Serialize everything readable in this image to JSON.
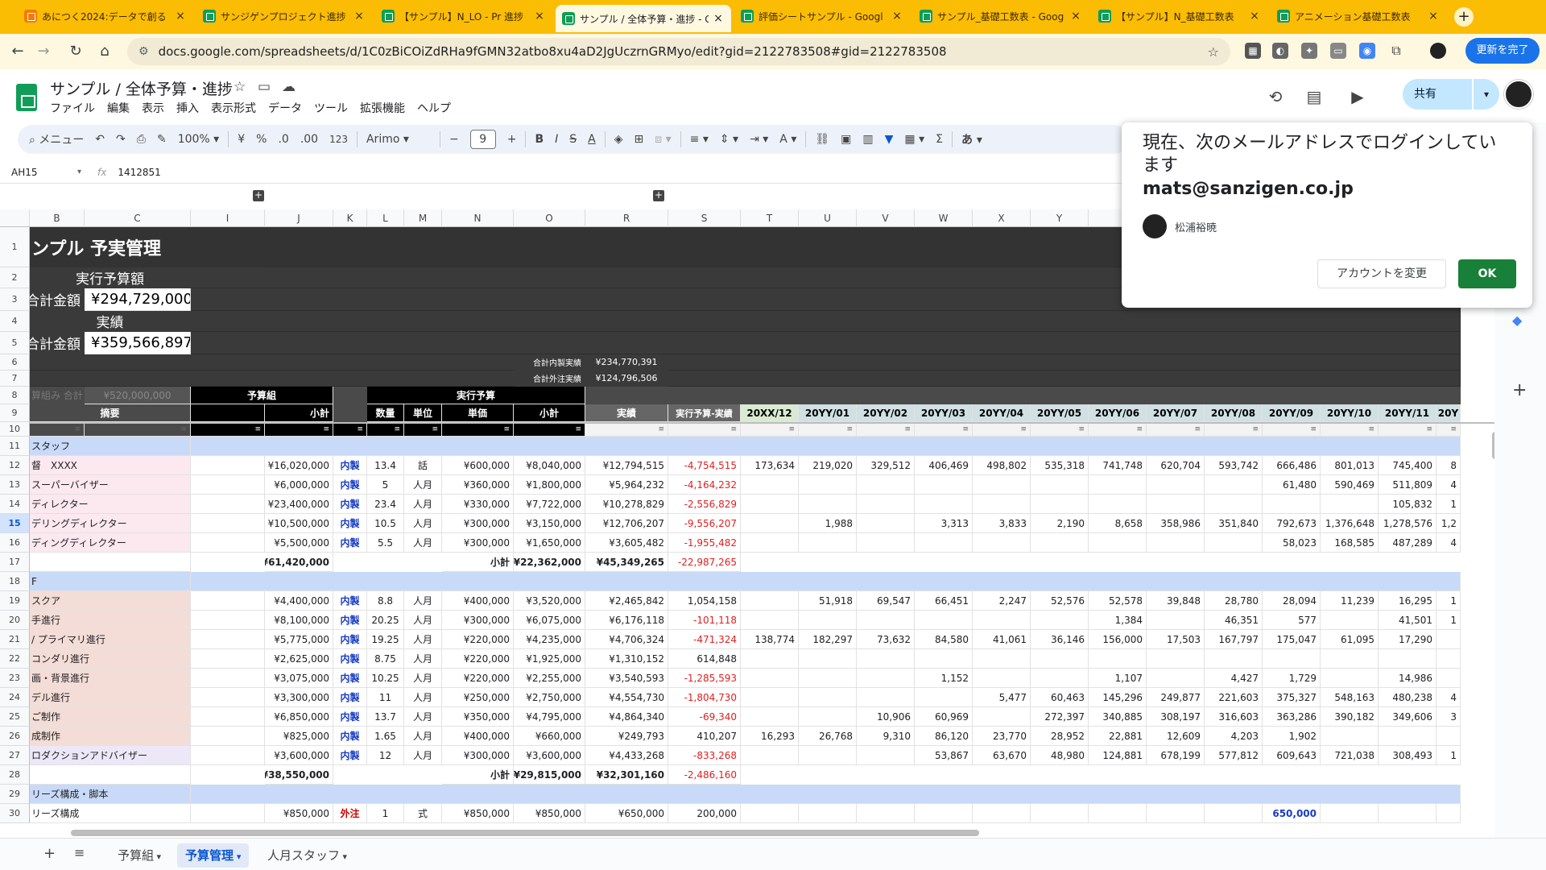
{
  "browser": {
    "tabs": [
      {
        "title": "あにつく2024:データで創る",
        "active": false,
        "fav": "orange"
      },
      {
        "title": "サンジゲンプロジェクト進捗",
        "active": false,
        "fav": "green"
      },
      {
        "title": "【サンプル】N_LO - Pr 進捗",
        "active": false,
        "fav": "green"
      },
      {
        "title": "サンプル / 全体予算・進捗 - G",
        "active": true,
        "fav": "green"
      },
      {
        "title": "評価シートサンプル - Googl",
        "active": false,
        "fav": "green"
      },
      {
        "title": "サンプル_基礎工数表 - Goog",
        "active": false,
        "fav": "green"
      },
      {
        "title": "【サンプル】N_基礎工数表",
        "active": false,
        "fav": "green"
      },
      {
        "title": "アニメーション基礎工数表",
        "active": false,
        "fav": "green"
      }
    ],
    "url": "docs.google.com/spreadsheets/d/1C0zBiCOiZdRHa9fGMN32atbo8xu4aD2JgUczrnGRMyo/edit?gid=2122783508#gid=2122783508",
    "update_label": "更新を完了"
  },
  "sheets": {
    "title": "サンプル / 全体予算・進捗",
    "menu": [
      "ファイル",
      "編集",
      "表示",
      "挿入",
      "表示形式",
      "データ",
      "ツール",
      "拡張機能",
      "ヘルプ"
    ],
    "share_label": "共有",
    "toolbar": {
      "search": "メニュー",
      "zoom": "100%",
      "currency": "¥",
      "percent": "%",
      "dec_dec": ".0",
      "inc_dec": ".00",
      "number": "123",
      "font": "Arimo",
      "font_size": "9"
    },
    "name_box": "AH15",
    "formula": "1412851"
  },
  "grid": {
    "columns": [
      {
        "name": "B",
        "w": 68
      },
      {
        "name": "C",
        "w": 132
      },
      {
        "name": "I",
        "w": 92
      },
      {
        "name": "J",
        "w": 85
      },
      {
        "name": "K",
        "w": 42
      },
      {
        "name": "L",
        "w": 46
      },
      {
        "name": "M",
        "w": 47
      },
      {
        "name": "N",
        "w": 89
      },
      {
        "name": "O",
        "w": 89
      },
      {
        "name": "R",
        "w": 103
      },
      {
        "name": "S",
        "w": 90
      },
      {
        "name": "T",
        "w": 72
      },
      {
        "name": "U",
        "w": 72
      },
      {
        "name": "V",
        "w": 72
      },
      {
        "name": "W",
        "w": 72
      },
      {
        "name": "X",
        "w": 72
      },
      {
        "name": "Y",
        "w": 72
      },
      {
        "name": "Z",
        "w": 72
      },
      {
        "name": "AA",
        "w": 72
      },
      {
        "name": "AB",
        "w": 72
      },
      {
        "name": "AC",
        "w": 72
      },
      {
        "name": "AD",
        "w": 72
      },
      {
        "name": "AE",
        "w": 72
      },
      {
        "name": "AF",
        "w": 30
      }
    ],
    "visible_col_letters": [
      "B",
      "C",
      "I",
      "J",
      "K",
      "L",
      "M",
      "N",
      "O",
      "R",
      "S",
      "T",
      "U",
      "V",
      "W",
      "X",
      "Y"
    ],
    "rows": [
      {
        "n": "1",
        "h": 50
      },
      {
        "n": "2",
        "h": 26
      },
      {
        "n": "3",
        "h": 28
      },
      {
        "n": "4",
        "h": 26
      },
      {
        "n": "5",
        "h": 28
      },
      {
        "n": "6",
        "h": 20
      },
      {
        "n": "7",
        "h": 20
      },
      {
        "n": "8",
        "h": 22
      },
      {
        "n": "9",
        "h": 22
      },
      {
        "n": "10",
        "h": 18
      },
      {
        "n": "11",
        "h": 24
      },
      {
        "n": "12",
        "h": 24
      },
      {
        "n": "13",
        "h": 24
      },
      {
        "n": "14",
        "h": 24
      },
      {
        "n": "15",
        "h": 24
      },
      {
        "n": "16",
        "h": 24
      },
      {
        "n": "17",
        "h": 24
      },
      {
        "n": "18",
        "h": 24
      },
      {
        "n": "19",
        "h": 24
      },
      {
        "n": "20",
        "h": 24
      },
      {
        "n": "21",
        "h": 24
      },
      {
        "n": "22",
        "h": 24
      },
      {
        "n": "23",
        "h": 24
      },
      {
        "n": "24",
        "h": 24
      },
      {
        "n": "25",
        "h": 24
      },
      {
        "n": "26",
        "h": 24
      },
      {
        "n": "27",
        "h": 24
      },
      {
        "n": "28",
        "h": 24
      },
      {
        "n": "29",
        "h": 24
      },
      {
        "n": "30",
        "h": 24
      }
    ],
    "selected_row": "15",
    "header_block": {
      "title": "ンプル 予実管理",
      "budget_label": "実行予算額",
      "budget_total_label": "合計金額",
      "budget_total": "¥294,729,000",
      "actual_label": "実績",
      "actual_total_label": "合計金額",
      "actual_total": "¥359,566,897",
      "inhouse_label": "合計内製実績",
      "inhouse_value": "¥234,770,391",
      "outsource_label": "合計外注実績",
      "outsource_value": "¥124,796,506",
      "kumi_label": "算組み 合計",
      "kumi_value": "¥520,000,000",
      "yosan_kumi": "予算組",
      "jikko_yosan": "実行予算",
      "tekiyo": "摘要",
      "shokei": "小計",
      "suryo": "数量",
      "tani": "単位",
      "tanka": "単価",
      "shokei2": "小計",
      "jisseki": "実績",
      "diff": "実行予算-実績",
      "months": [
        "20XX/12",
        "20YY/01",
        "20YY/02",
        "20YY/03",
        "20YY/04",
        "20YY/05",
        "20YY/06",
        "20YY/07",
        "20YY/08",
        "20YY/09",
        "20YY/10",
        "20YY/11",
        "20Y"
      ]
    },
    "data_rows": [
      {
        "row": "11",
        "type": "section",
        "label": "スタッフ"
      },
      {
        "row": "12",
        "name": "XXXX",
        "pre": "督",
        "J": "¥16,020,000",
        "K": "内製",
        "L": "13.4",
        "M": "話",
        "N": "¥600,000",
        "O": "¥8,040,000",
        "R": "¥12,794,515",
        "S": "-4,754,515",
        "m": [
          "173,634",
          "219,020",
          "329,512",
          "406,469",
          "498,802",
          "535,318",
          "741,748",
          "620,704",
          "593,742",
          "666,486",
          "801,013",
          "745,400",
          "8"
        ]
      },
      {
        "row": "13",
        "name": "スーパーバイザー",
        "J": "¥6,000,000",
        "K": "内製",
        "L": "5",
        "M": "人月",
        "N": "¥360,000",
        "O": "¥1,800,000",
        "R": "¥5,964,232",
        "S": "-4,164,232",
        "m": [
          "",
          "",
          "",
          "",
          "",
          "",
          "",
          "",
          "",
          "61,480",
          "590,469",
          "511,809",
          "4"
        ]
      },
      {
        "row": "14",
        "name": "ディレクター",
        "J": "¥23,400,000",
        "K": "内製",
        "L": "23.4",
        "M": "人月",
        "N": "¥330,000",
        "O": "¥7,722,000",
        "R": "¥10,278,829",
        "S": "-2,556,829",
        "m": [
          "",
          "",
          "",
          "",
          "",
          "",
          "",
          "",
          "",
          "",
          "",
          "105,832",
          "1"
        ]
      },
      {
        "row": "15",
        "name": "デリングディレクター",
        "J": "¥10,500,000",
        "K": "内製",
        "L": "10.5",
        "M": "人月",
        "N": "¥300,000",
        "O": "¥3,150,000",
        "R": "¥12,706,207",
        "S": "-9,556,207",
        "m": [
          "",
          "1,988",
          "",
          "3,313",
          "3,833",
          "2,190",
          "8,658",
          "358,986",
          "351,840",
          "792,673",
          "1,376,648",
          "1,278,576",
          "1,2"
        ]
      },
      {
        "row": "16",
        "name": "ディングディレクター",
        "J": "¥5,500,000",
        "K": "内製",
        "L": "5.5",
        "M": "人月",
        "N": "¥300,000",
        "O": "¥1,650,000",
        "R": "¥3,605,482",
        "S": "-1,955,482",
        "m": [
          "",
          "",
          "",
          "",
          "",
          "",
          "",
          "",
          "",
          "58,023",
          "168,585",
          "487,289",
          "4"
        ]
      },
      {
        "row": "17",
        "type": "subtotal",
        "J": "¥61,420,000",
        "N": "小計",
        "O": "¥22,362,000",
        "R": "¥45,349,265",
        "S": "-22,987,265"
      },
      {
        "row": "18",
        "type": "section",
        "label": "F"
      },
      {
        "row": "19",
        "name": "スクア",
        "J": "¥4,400,000",
        "K": "内製",
        "L": "8.8",
        "M": "人月",
        "N": "¥400,000",
        "O": "¥3,520,000",
        "R": "¥2,465,842",
        "S": "1,054,158",
        "m": [
          "",
          "51,918",
          "69,547",
          "66,451",
          "2,247",
          "52,576",
          "52,578",
          "39,848",
          "28,780",
          "28,094",
          "11,239",
          "16,295",
          "1"
        ]
      },
      {
        "row": "20",
        "name": "手進行",
        "J": "¥8,100,000",
        "K": "内製",
        "L": "20.25",
        "M": "人月",
        "N": "¥300,000",
        "O": "¥6,075,000",
        "R": "¥6,176,118",
        "S": "-101,118",
        "m": [
          "",
          "",
          "",
          "",
          "",
          "",
          "1,384",
          "",
          "46,351",
          "577",
          "",
          "41,501",
          "1"
        ]
      },
      {
        "row": "21",
        "name": "/ プライマリ進行",
        "J": "¥5,775,000",
        "K": "内製",
        "L": "19.25",
        "M": "人月",
        "N": "¥220,000",
        "O": "¥4,235,000",
        "R": "¥4,706,324",
        "S": "-471,324",
        "m": [
          "138,774",
          "182,297",
          "73,632",
          "84,580",
          "41,061",
          "36,146",
          "156,000",
          "17,503",
          "167,797",
          "175,047",
          "61,095",
          "17,290",
          ""
        ]
      },
      {
        "row": "22",
        "name": "コンダリ進行",
        "J": "¥2,625,000",
        "K": "内製",
        "L": "8.75",
        "M": "人月",
        "N": "¥220,000",
        "O": "¥1,925,000",
        "R": "¥1,310,152",
        "S": "614,848",
        "m": [
          "",
          "",
          "",
          "",
          "",
          "",
          "",
          "",
          "",
          "",
          "",
          "",
          ""
        ]
      },
      {
        "row": "23",
        "name": "画・背景進行",
        "J": "¥3,075,000",
        "K": "内製",
        "L": "10.25",
        "M": "人月",
        "N": "¥220,000",
        "O": "¥2,255,000",
        "R": "¥3,540,593",
        "S": "-1,285,593",
        "m": [
          "",
          "",
          "",
          "1,152",
          "",
          "",
          "1,107",
          "",
          "4,427",
          "1,729",
          "",
          "14,986",
          ""
        ]
      },
      {
        "row": "24",
        "name": "デル進行",
        "J": "¥3,300,000",
        "K": "内製",
        "L": "11",
        "M": "人月",
        "N": "¥250,000",
        "O": "¥2,750,000",
        "R": "¥4,554,730",
        "S": "-1,804,730",
        "m": [
          "",
          "",
          "",
          "",
          "5,477",
          "60,463",
          "145,296",
          "249,877",
          "221,603",
          "375,327",
          "548,163",
          "480,238",
          "4"
        ]
      },
      {
        "row": "25",
        "name": "ご制作",
        "J": "¥6,850,000",
        "K": "内製",
        "L": "13.7",
        "M": "人月",
        "N": "¥350,000",
        "O": "¥4,795,000",
        "R": "¥4,864,340",
        "S": "-69,340",
        "m": [
          "",
          "",
          "10,906",
          "60,969",
          "",
          "272,397",
          "340,885",
          "308,197",
          "316,603",
          "363,286",
          "390,182",
          "349,606",
          "3"
        ]
      },
      {
        "row": "26",
        "name": "成制作",
        "J": "¥825,000",
        "K": "内製",
        "L": "1.65",
        "M": "人月",
        "N": "¥400,000",
        "O": "¥660,000",
        "R": "¥249,793",
        "S": "410,207",
        "m": [
          "16,293",
          "26,768",
          "9,310",
          "86,120",
          "23,770",
          "28,952",
          "22,881",
          "12,609",
          "4,203",
          "1,902",
          "",
          "",
          ""
        ]
      },
      {
        "row": "27",
        "name": "ロダクションアドバイザー",
        "J": "¥3,600,000",
        "K": "内製",
        "L": "12",
        "M": "人月",
        "N": "¥300,000",
        "O": "¥3,600,000",
        "R": "¥4,433,268",
        "S": "-833,268",
        "m": [
          "",
          "",
          "",
          "53,867",
          "63,670",
          "48,980",
          "124,881",
          "678,199",
          "577,812",
          "609,643",
          "721,038",
          "308,493",
          "1"
        ]
      },
      {
        "row": "28",
        "type": "subtotal",
        "J": "¥38,550,000",
        "N": "小計",
        "O": "¥29,815,000",
        "R": "¥32,301,160",
        "S": "-2,486,160"
      },
      {
        "row": "29",
        "type": "section",
        "label": "リーズ構成・脚本"
      },
      {
        "row": "30",
        "name": "リーズ構成",
        "J": "¥850,000",
        "K": "外注",
        "L": "1",
        "M": "式",
        "N": "¥850,000",
        "O": "¥850,000",
        "R": "¥650,000",
        "S": "200,000",
        "m": [
          "",
          "",
          "",
          "",
          "",
          "",
          "",
          "",
          "",
          "650,000",
          "",
          "",
          ""
        ]
      }
    ]
  },
  "dialog": {
    "title": "現在、次のメールアドレスでログインしています",
    "email": "mats@sanzigen.co.jp",
    "user": "松浦裕暁",
    "change_label": "アカウントを変更",
    "ok_label": "OK"
  },
  "bottom": {
    "tabs": [
      {
        "label": "予算組",
        "active": false
      },
      {
        "label": "予算管理",
        "active": true
      },
      {
        "label": "人月スタッフ",
        "active": false
      }
    ]
  },
  "colors": {
    "chrome": "#fbbc04",
    "dark_panel": "#3a3a3a",
    "header_row": "#4a4a4a",
    "section": "#c9daf8",
    "month_hdr": "#d0e0e3",
    "share": "#c2e7ff",
    "ok": "#188038"
  }
}
